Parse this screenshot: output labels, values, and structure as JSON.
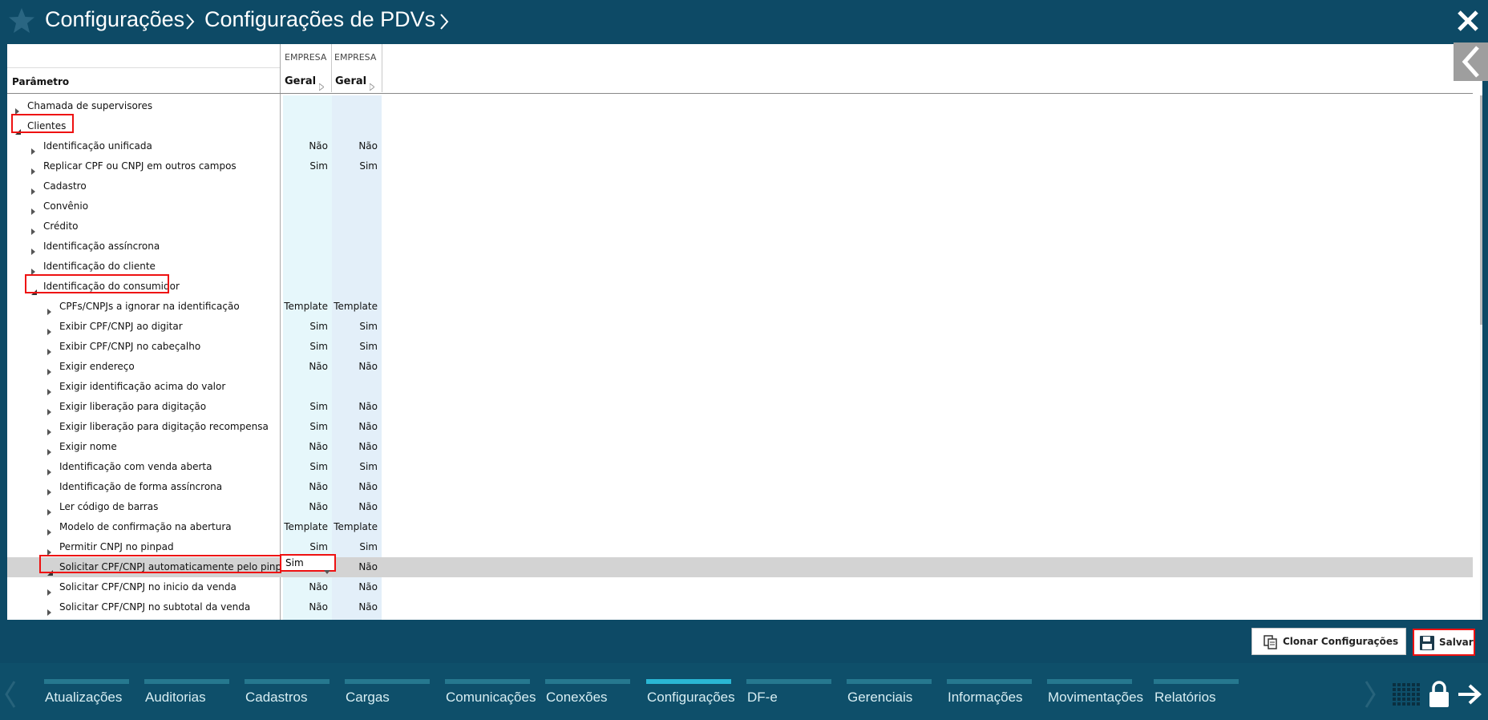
{
  "colors": {
    "header_bg": "#0d4a66",
    "accent": "#2ab7d5",
    "highlight": "#e11111",
    "selected_row": "#d3d3d3"
  },
  "header": {
    "breadcrumb": [
      "Configurações",
      "Configurações de PDVs"
    ]
  },
  "columns": {
    "param_header": "Parâmetro",
    "group_labels": [
      "EMPRESA",
      "EMPRESA"
    ],
    "col_labels": [
      "Geral",
      "Geral"
    ]
  },
  "rows": [
    {
      "label": "Chamada de supervisores",
      "level": 0,
      "expanded": false,
      "v1": "",
      "v2": ""
    },
    {
      "label": "Clientes",
      "level": 0,
      "expanded": true,
      "v1": "",
      "v2": ""
    },
    {
      "label": "Identificação unificada",
      "level": 1,
      "expanded": false,
      "v1": "Não",
      "v2": "Não"
    },
    {
      "label": "Replicar CPF ou CNPJ em outros campos",
      "level": 1,
      "expanded": false,
      "v1": "Sim",
      "v2": "Sim"
    },
    {
      "label": "Cadastro",
      "level": 1,
      "expanded": false,
      "v1": "",
      "v2": ""
    },
    {
      "label": "Convênio",
      "level": 1,
      "expanded": false,
      "v1": "",
      "v2": ""
    },
    {
      "label": "Crédito",
      "level": 1,
      "expanded": false,
      "v1": "",
      "v2": ""
    },
    {
      "label": "Identificação assíncrona",
      "level": 1,
      "expanded": false,
      "v1": "",
      "v2": ""
    },
    {
      "label": "Identificação do cliente",
      "level": 1,
      "expanded": false,
      "v1": "",
      "v2": ""
    },
    {
      "label": "Identificação do consumidor",
      "level": 1,
      "expanded": true,
      "v1": "",
      "v2": ""
    },
    {
      "label": "CPFs/CNPJs a ignorar na identificação",
      "level": 2,
      "expanded": false,
      "v1": "Template",
      "v2": "Template"
    },
    {
      "label": "Exibir CPF/CNPJ ao digitar",
      "level": 2,
      "expanded": false,
      "v1": "Sim",
      "v2": "Sim"
    },
    {
      "label": "Exibir CPF/CNPJ no cabeçalho",
      "level": 2,
      "expanded": false,
      "v1": "Sim",
      "v2": "Sim"
    },
    {
      "label": "Exigir endereço",
      "level": 2,
      "expanded": false,
      "v1": "Não",
      "v2": "Não"
    },
    {
      "label": "Exigir identificação acima do valor",
      "level": 2,
      "expanded": false,
      "v1": "",
      "v2": ""
    },
    {
      "label": "Exigir liberação para digitação",
      "level": 2,
      "expanded": false,
      "v1": "Sim",
      "v2": "Não"
    },
    {
      "label": "Exigir liberação para digitação recompensa",
      "level": 2,
      "expanded": false,
      "v1": "Sim",
      "v2": "Não"
    },
    {
      "label": "Exigir nome",
      "level": 2,
      "expanded": false,
      "v1": "Não",
      "v2": "Não"
    },
    {
      "label": "Identificação com venda aberta",
      "level": 2,
      "expanded": false,
      "v1": "Sim",
      "v2": "Sim"
    },
    {
      "label": "Identificação de forma assíncrona",
      "level": 2,
      "expanded": false,
      "v1": "Não",
      "v2": "Não"
    },
    {
      "label": "Ler código de barras",
      "level": 2,
      "expanded": false,
      "v1": "Não",
      "v2": "Não"
    },
    {
      "label": "Modelo de confirmação na abertura",
      "level": 2,
      "expanded": false,
      "v1": "Template",
      "v2": "Template"
    },
    {
      "label": "Permitir CNPJ no pinpad",
      "level": 2,
      "expanded": false,
      "v1": "Sim",
      "v2": "Sim"
    },
    {
      "label": "Solicitar CPF/CNPJ automaticamente pelo pinpad",
      "level": 2,
      "expanded": true,
      "v1": "",
      "v2": "Não",
      "selected": true
    },
    {
      "label": "Solicitar CPF/CNPJ no inicio da venda",
      "level": 2,
      "expanded": false,
      "v1": "Não",
      "v2": "Não"
    },
    {
      "label": "Solicitar CPF/CNPJ no subtotal da venda",
      "level": 2,
      "expanded": false,
      "v1": "Não",
      "v2": "Não"
    }
  ],
  "editor": {
    "value": "Sim"
  },
  "actions": {
    "clone_label": "Clonar Configurações",
    "save_label": "Salvar"
  },
  "nav": {
    "items": [
      "Atualizações",
      "Auditorias",
      "Cadastros",
      "Cargas",
      "Comunicações",
      "Conexões",
      "Configurações",
      "DF-e",
      "Gerenciais",
      "Informações",
      "Movimentações",
      "Relatórios"
    ],
    "active": "Configurações"
  }
}
